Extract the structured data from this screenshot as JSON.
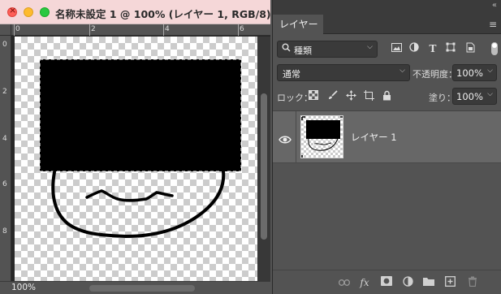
{
  "document": {
    "title": "名称未設定 1 @ 100% (レイヤー 1, RGB/8) *",
    "zoom_status": "100%",
    "ruler_top_labels": [
      "0",
      "2",
      "4",
      "6"
    ],
    "ruler_left_labels": [
      "0",
      "2",
      "4",
      "6",
      "8"
    ]
  },
  "panel": {
    "tab_label": "レイヤー",
    "filter": {
      "kind_label": "種類",
      "icons": [
        "image-filter-icon",
        "adjustment-filter-icon",
        "type-filter-icon",
        "shape-filter-icon",
        "smart-object-filter-icon"
      ]
    },
    "blend_mode": "通常",
    "opacity_label": "不透明度：",
    "opacity_value": "100%",
    "lock_label": "ロック：",
    "fill_label": "塗り：",
    "fill_value": "100%",
    "layers": [
      {
        "name": "レイヤー 1",
        "visible": true,
        "selected": true
      }
    ],
    "footer_icons": [
      "link-layers-icon",
      "fx-icon",
      "add-mask-icon",
      "adjustment-layer-icon",
      "new-group-icon",
      "new-layer-icon",
      "delete-layer-icon"
    ]
  },
  "colors": {
    "title_bar": "#f5d7d8",
    "panel_bg": "#535353",
    "selected_layer": "#676767"
  }
}
